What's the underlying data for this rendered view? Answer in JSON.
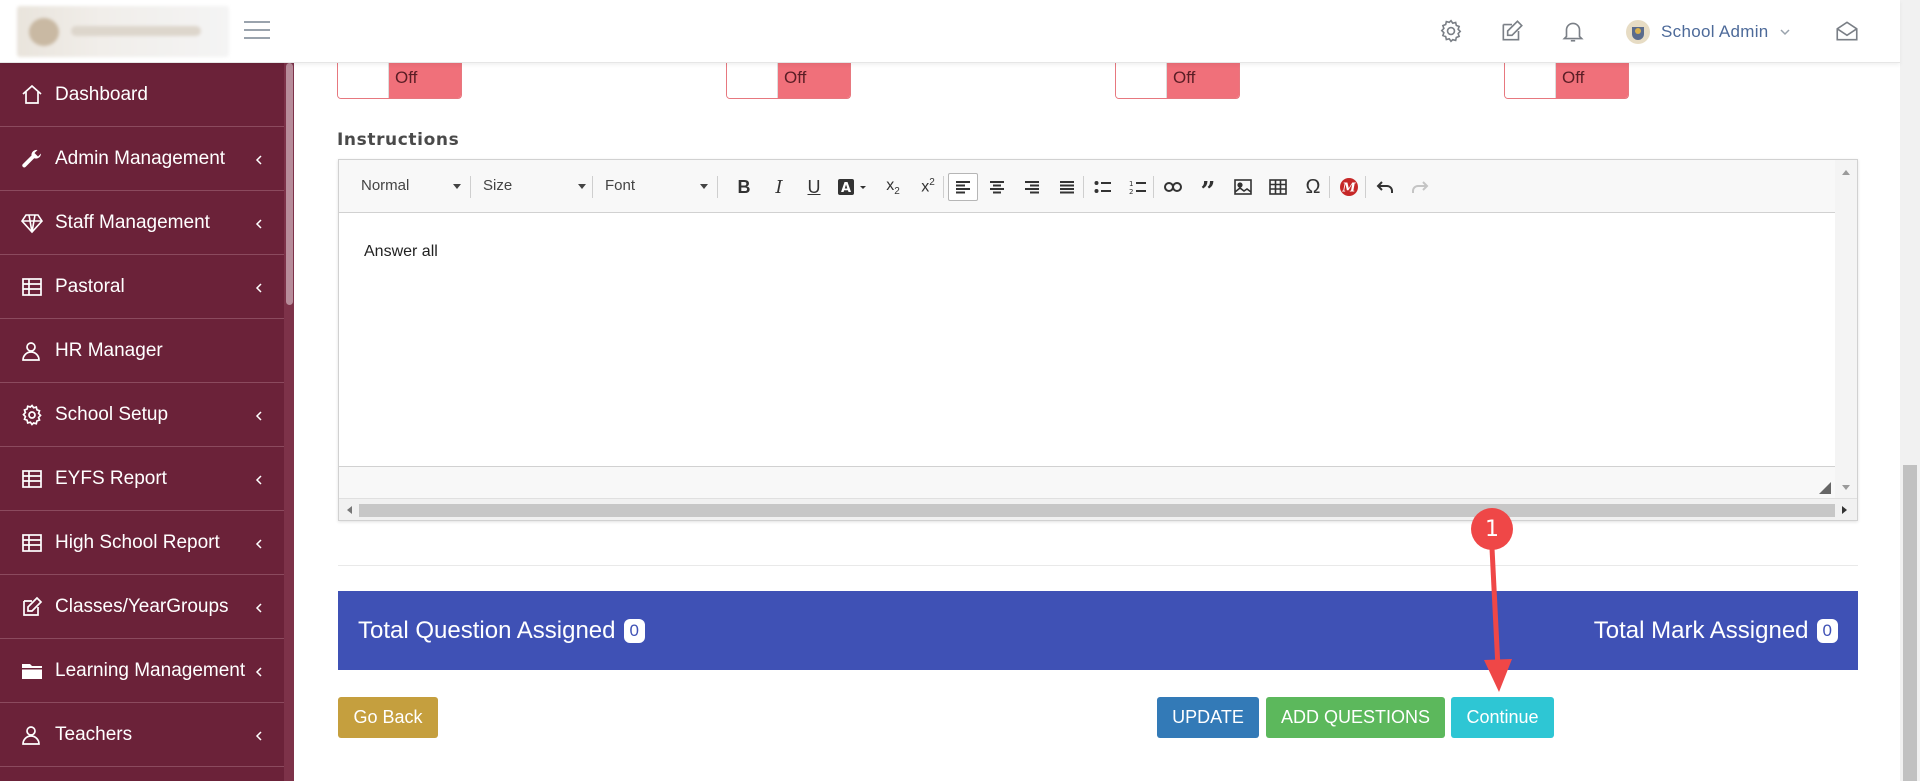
{
  "header": {
    "profile_name": "School Admin",
    "icons": [
      "settings-icon",
      "edit-icon",
      "bell-icon",
      "chevron-down-icon",
      "envelope-open-icon"
    ]
  },
  "sidebar": {
    "items": [
      {
        "label": "Dashboard",
        "icon": "home-icon",
        "has_children": false
      },
      {
        "label": "Admin Management",
        "icon": "wrench-icon",
        "has_children": true
      },
      {
        "label": "Staff Management",
        "icon": "diamond-icon",
        "has_children": true
      },
      {
        "label": "Pastoral",
        "icon": "table-icon",
        "has_children": true
      },
      {
        "label": "HR Manager",
        "icon": "user-icon",
        "has_children": false
      },
      {
        "label": "School Setup",
        "icon": "gear-icon",
        "has_children": true
      },
      {
        "label": "EYFS Report",
        "icon": "table-icon",
        "has_children": true
      },
      {
        "label": "High School Report",
        "icon": "table-icon",
        "has_children": true
      },
      {
        "label": "Classes/YearGroups",
        "icon": "edit-icon",
        "has_children": true
      },
      {
        "label": "Learning Management",
        "icon": "folder-icon",
        "has_children": true
      },
      {
        "label": "Teachers",
        "icon": "user-icon",
        "has_children": true
      }
    ]
  },
  "toggles": [
    {
      "label": "Off",
      "state": "off"
    },
    {
      "label": "Off",
      "state": "off"
    },
    {
      "label": "Off",
      "state": "off"
    },
    {
      "label": "Off",
      "state": "off"
    }
  ],
  "instructions": {
    "label": "Instructions",
    "content": "Answer all",
    "toolbar": {
      "format_label": "Normal",
      "size_label": "Size",
      "font_label": "Font"
    }
  },
  "summary": {
    "questions_label": "Total Question Assigned",
    "questions_count": "0",
    "marks_label": "Total Mark Assigned",
    "marks_count": "0"
  },
  "buttons": {
    "back": "Go Back",
    "update": "UPDATE",
    "add_questions": "ADD QUESTIONS",
    "continue": "Continue"
  },
  "annotation": {
    "badge": "1"
  },
  "colors": {
    "sidebar_bg": "#6b2239",
    "summary_bg": "#3f51b5",
    "toggle_off": "#f0707a",
    "back_btn": "#c59f3e",
    "update_btn": "#337ab7",
    "add_btn": "#5cb85c",
    "continue_btn": "#2ec6d4",
    "annotation": "#ef4747"
  }
}
